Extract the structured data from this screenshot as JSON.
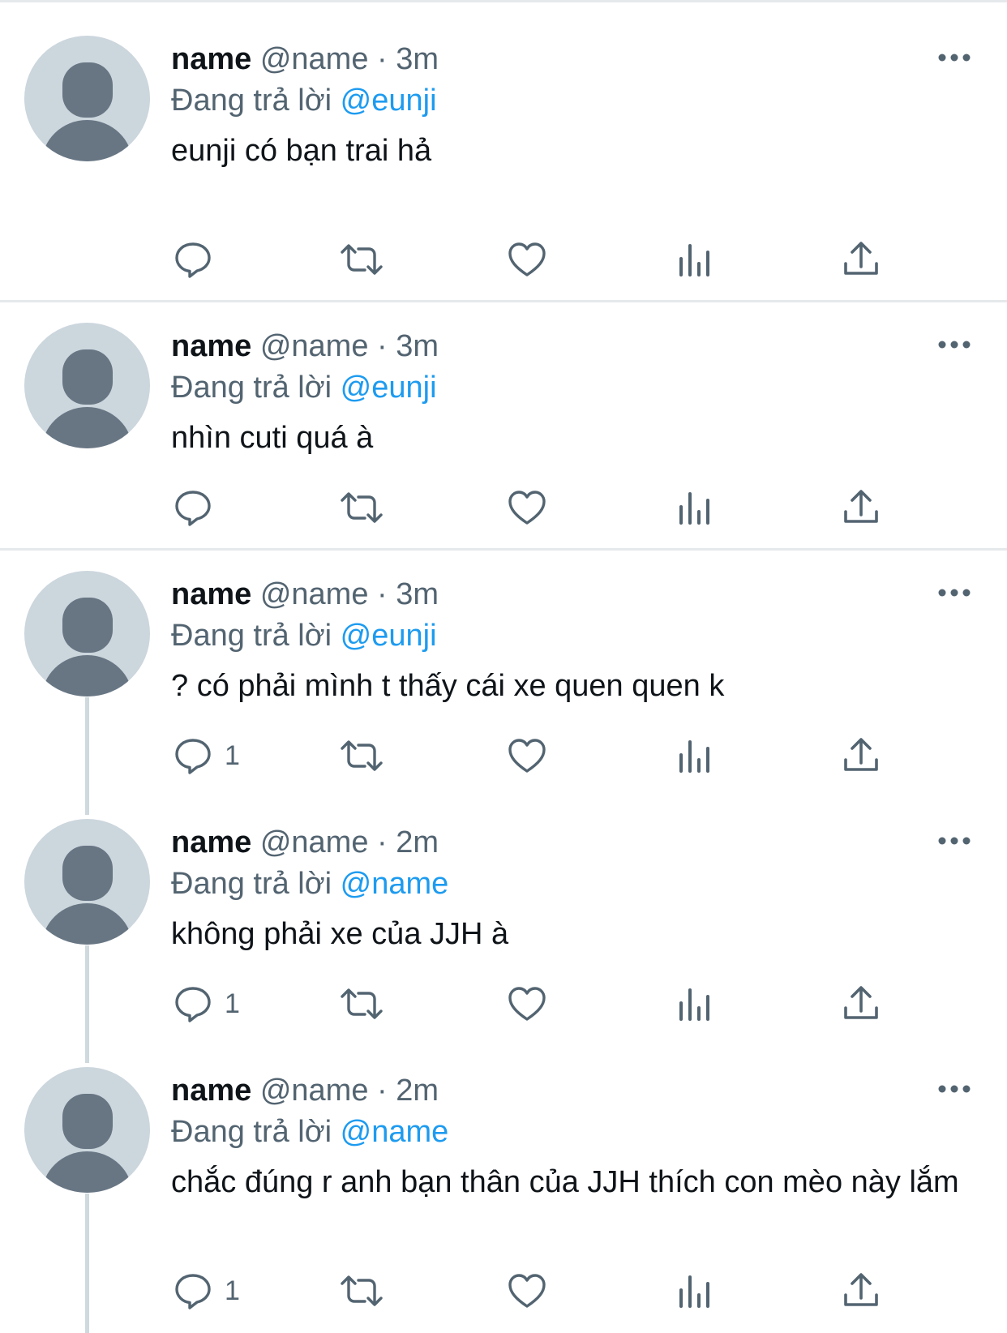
{
  "tweets": [
    {
      "display_name": "name",
      "handle": "@name",
      "separator": "·",
      "time": "3m",
      "reply_prefix": "Đang trả lời",
      "reply_to": "@eunji",
      "text": "eunji có bạn trai hả",
      "reply_count": ""
    },
    {
      "display_name": "name",
      "handle": "@name",
      "separator": "·",
      "time": "3m",
      "reply_prefix": "Đang trả lời",
      "reply_to": "@eunji",
      "text": "nhìn cuti quá à",
      "reply_count": ""
    },
    {
      "display_name": "name",
      "handle": "@name",
      "separator": "·",
      "time": "3m",
      "reply_prefix": "Đang trả lời",
      "reply_to": "@eunji",
      "text": "? có phải mình t thấy cái xe quen quen k",
      "reply_count": "1"
    },
    {
      "display_name": "name",
      "handle": "@name",
      "separator": "·",
      "time": "2m",
      "reply_prefix": "Đang trả lời",
      "reply_to": "@name",
      "text": "không phải xe của JJH à",
      "reply_count": "1"
    },
    {
      "display_name": "name",
      "handle": "@name",
      "separator": "·",
      "time": "2m",
      "reply_prefix": "Đang trả lời",
      "reply_to": "@name",
      "text": "chắc đúng r anh bạn thân của JJH thích con mèo này lắm",
      "reply_count": "1"
    }
  ],
  "icons": {
    "reply": "reply-icon",
    "retweet": "retweet-icon",
    "like": "heart-icon",
    "views": "analytics-icon",
    "share": "share-icon",
    "more": "more-icon"
  },
  "colors": {
    "mention": "#1d9bf0",
    "secondary_text": "#536471",
    "avatar_bg": "#ccd6dd",
    "avatar_fg": "#687684"
  }
}
